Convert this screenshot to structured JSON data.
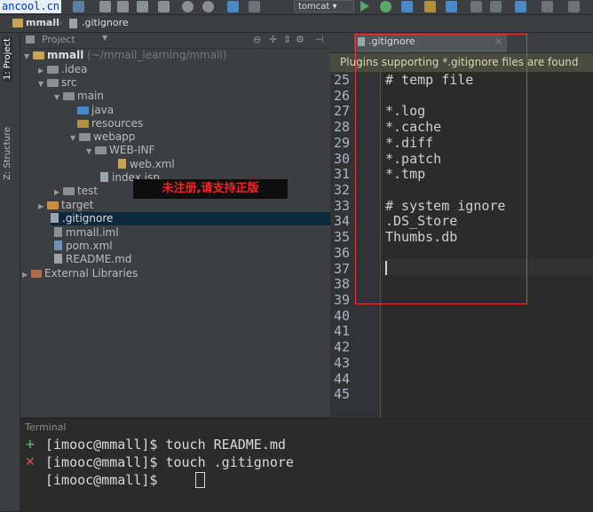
{
  "toolbar": {
    "watermark": "ancool.cn",
    "run_config": "tomcat ▾",
    "colors": {
      "run": "#59a869",
      "debug": "#4a88c7"
    }
  },
  "navbar": {
    "project_crumb": "mmall",
    "file_crumb": ".gitignore"
  },
  "tool_stripe": {
    "project_tab": "1: Project",
    "structure_tab": "Z: Structure"
  },
  "project_panel": {
    "header": "Project",
    "tree": [
      {
        "label": "mmall",
        "suffix": "(~/mmall_learning/mmall)",
        "kind": "module"
      },
      {
        "label": ".idea",
        "kind": "folder"
      },
      {
        "label": "src",
        "kind": "folder"
      },
      {
        "label": "main",
        "kind": "folder"
      },
      {
        "label": "java",
        "kind": "source-folder"
      },
      {
        "label": "resources",
        "kind": "resource-folder"
      },
      {
        "label": "webapp",
        "kind": "web-folder"
      },
      {
        "label": "WEB-INF",
        "kind": "folder"
      },
      {
        "label": "web.xml",
        "kind": "xml-file"
      },
      {
        "label": "index.jsp",
        "kind": "jsp-file"
      },
      {
        "label": "test",
        "kind": "folder"
      },
      {
        "label": "target",
        "kind": "excluded-folder"
      },
      {
        "label": ".gitignore",
        "kind": "file",
        "selected": true
      },
      {
        "label": "mmall.iml",
        "kind": "iml-file"
      },
      {
        "label": "pom.xml",
        "kind": "maven-file"
      },
      {
        "label": "README.md",
        "kind": "md-file"
      },
      {
        "label": "External Libraries",
        "kind": "libraries"
      }
    ]
  },
  "banner": "未注册,请支持正版",
  "editor": {
    "tab_label": ".gitignore",
    "notice": "Plugins supporting *.gitignore files are found",
    "lines": [
      {
        "n": "25",
        "text": "# temp file"
      },
      {
        "n": "26",
        "text": ""
      },
      {
        "n": "27",
        "text": "*.log"
      },
      {
        "n": "28",
        "text": "*.cache"
      },
      {
        "n": "29",
        "text": "*.diff"
      },
      {
        "n": "30",
        "text": "*.patch"
      },
      {
        "n": "31",
        "text": "*.tmp"
      },
      {
        "n": "32",
        "text": ""
      },
      {
        "n": "33",
        "text": "# system ignore"
      },
      {
        "n": "34",
        "text": ".DS_Store"
      },
      {
        "n": "35",
        "text": "Thumbs.db"
      },
      {
        "n": "36",
        "text": ""
      },
      {
        "n": "37",
        "text": ""
      },
      {
        "n": "38",
        "text": ""
      },
      {
        "n": "39",
        "text": ""
      },
      {
        "n": "40",
        "text": ""
      },
      {
        "n": "41",
        "text": ""
      },
      {
        "n": "42",
        "text": ""
      },
      {
        "n": "43",
        "text": ""
      },
      {
        "n": "44",
        "text": ""
      },
      {
        "n": "45",
        "text": ""
      }
    ]
  },
  "terminal": {
    "label": "Terminal",
    "lines": [
      "[imooc@mmall]$ touch README.md",
      "[imooc@mmall]$ touch .gitignore",
      "[imooc@mmall]$ "
    ],
    "icons": [
      "plus-icon",
      "close-icon"
    ]
  }
}
